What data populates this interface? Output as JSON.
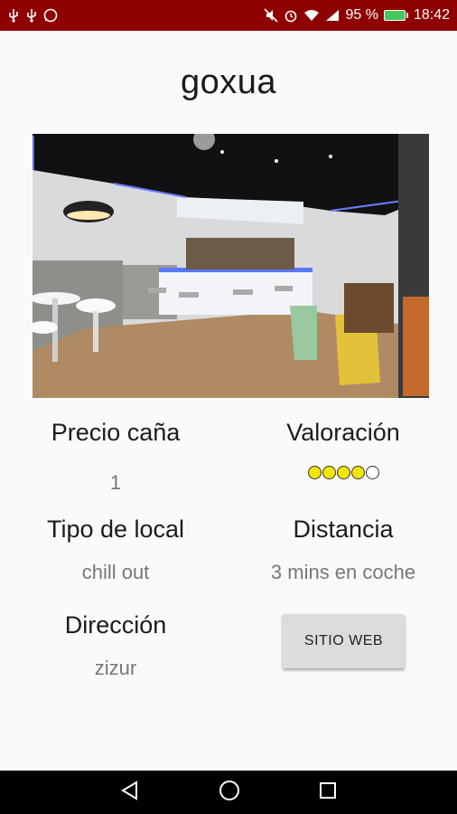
{
  "status_bar": {
    "battery_percent": "95 %",
    "time": "18:42",
    "left_icons": [
      "usb-icon",
      "usb-icon",
      "whatsapp-icon"
    ],
    "right_icons": [
      "mute-icon",
      "alarm-icon",
      "wifi-icon",
      "signal-icon",
      "battery-icon"
    ]
  },
  "page": {
    "title": "goxua"
  },
  "details": {
    "price_label": "Precio caña",
    "price_value": "1",
    "rating_label": "Valoración",
    "rating_value": 4,
    "rating_max": 5,
    "type_label": "Tipo de local",
    "type_value": "chill out",
    "distance_label": "Distancia",
    "distance_value": "3 mins en coche",
    "address_label": "Dirección",
    "address_value": "zizur",
    "website_button": "SITIO WEB"
  },
  "navbar": {
    "icons": [
      "back-icon",
      "home-icon",
      "recents-icon"
    ]
  },
  "colors": {
    "status_bar": "#8e0000",
    "star_on": "#f2e600",
    "button_bg": "#dcdcdc"
  }
}
